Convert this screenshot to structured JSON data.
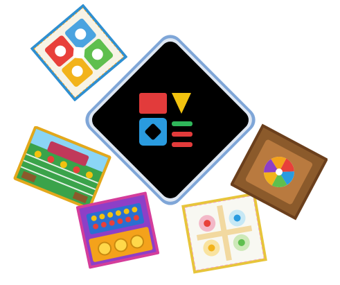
{
  "device": {
    "brand_text": "",
    "screen_color": "#000000",
    "frame_color": "#dfe7f2",
    "logo": {
      "square_color": "#e23b3b",
      "triangle_color": "#f2c20f",
      "diamond_color": "#2a9bdf",
      "bar_top_color": "#2fb65a",
      "bar_bottom_color": "#e23b3b"
    }
  },
  "boards": [
    {
      "name": "ludo-board-top",
      "theme": "ludo",
      "bg": "#f7f3e6",
      "border": "#2e8fd1"
    },
    {
      "name": "football-board-left",
      "theme": "football",
      "bg": "#3aa34a",
      "border": "#e3a81c"
    },
    {
      "name": "bingo-board-bottom-left",
      "theme": "arcade",
      "bg": "#8d3fc7",
      "border": "#d43d9b"
    },
    {
      "name": "ludo-board-bottom-right",
      "theme": "ludo-light",
      "bg": "#f8f8f2",
      "border": "#e7c53a"
    },
    {
      "name": "wheel-board-right",
      "theme": "wheel",
      "bg": "#8b5a2b",
      "border": "#6b3f1c"
    }
  ]
}
